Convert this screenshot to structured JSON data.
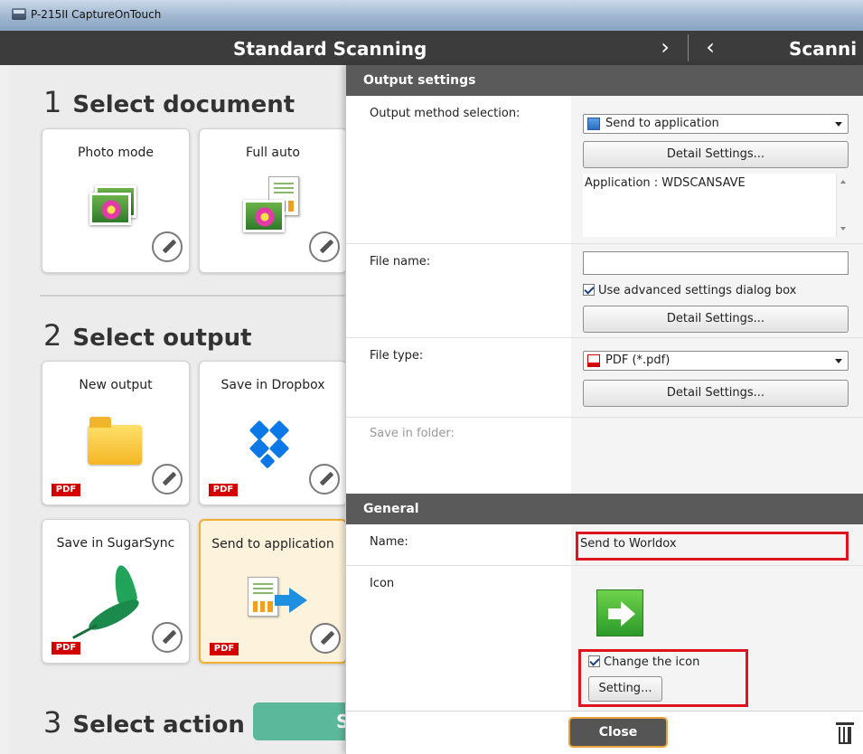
{
  "window": {
    "title": "P-215II CaptureOnTouch"
  },
  "header": {
    "title": "Standard Scanning",
    "next_glyph": "›",
    "prev_glyph": "‹",
    "second_title": "Scanni"
  },
  "left": {
    "step1": {
      "num": "1",
      "label": "Select document"
    },
    "documents": [
      {
        "label": "Photo mode"
      },
      {
        "label": "Full auto"
      }
    ],
    "step2": {
      "num": "2",
      "label": "Select output"
    },
    "outputs": [
      {
        "label": "New output",
        "badge": "PDF"
      },
      {
        "label": "Save in Dropbox",
        "badge": "PDF"
      },
      {
        "label": "Save in SugarSync",
        "badge": "PDF"
      },
      {
        "label": "Send to application",
        "badge": "PDF",
        "selected": true
      }
    ],
    "step3": {
      "num": "3",
      "label": "Select action"
    },
    "action_button_label": "S"
  },
  "right": {
    "output_settings": {
      "heading": "Output settings",
      "method_label": "Output method selection:",
      "method_value": "Send to application",
      "detail_button": "Detail Settings...",
      "application_info": "Application : WDSCANSAVE",
      "file_name_label": "File name:",
      "file_name_value": "",
      "use_advanced_label": "Use advanced settings dialog box",
      "use_advanced_checked": true,
      "file_type_label": "File type:",
      "file_type_value": "PDF (*.pdf)",
      "save_in_folder_label": "Save in folder:"
    },
    "general": {
      "heading": "General",
      "name_label": "Name:",
      "name_value": "Send to Worldox",
      "icon_label": "Icon",
      "change_icon_label": "Change the icon",
      "change_icon_checked": true,
      "setting_button": "Setting..."
    },
    "footer": {
      "close_button": "Close"
    }
  },
  "colors": {
    "accent_orange": "#f0b030",
    "highlight_red": "#e0141e",
    "pdf_red": "#d40000",
    "action_green": "#5cb89a"
  }
}
